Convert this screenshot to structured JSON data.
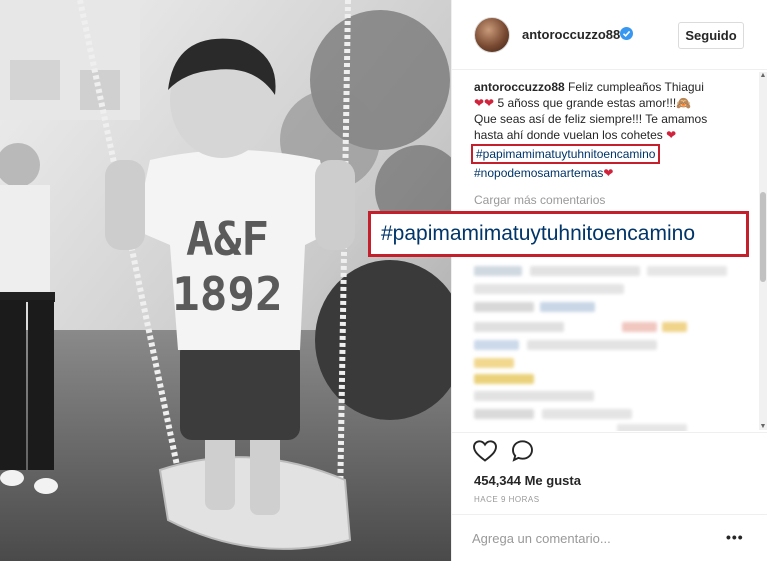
{
  "post": {
    "username": "antoroccuzzo88",
    "follow_label": "Seguido",
    "caption": {
      "username": "antoroccuzzo88",
      "line1_text": "Feliz cumpleaños Thiagui",
      "line2_hearts": "❤❤",
      "line2_text": " 5 añoss que grande estas amor!!!🙈",
      "line3_text": "Que seas así de feliz siempre!!! Te amamos",
      "line4_text": "hasta ahí donde vuelan los cohetes ",
      "line4_heart": "❤",
      "hashtag1": "#papimamimatuytuhnitoencamino",
      "hashtag2": "#nopodemosamartemas",
      "hashtag2_heart": "❤"
    },
    "load_more_label": "Cargar más comentarios",
    "likes_text": "454,344 Me gusta",
    "time_text": "HACE 9 HORAS",
    "comment_placeholder": "Agrega un comentario...",
    "more_label": "•••"
  },
  "overlay": {
    "hashtag": "#papimamimatuytuhnitoencamino"
  },
  "photo": {
    "shirt_line1": "A&F",
    "shirt_line2": "1892"
  },
  "colors": {
    "hashtag": "#003569",
    "highlight_border": "#c4202b",
    "heart": "#d0243c",
    "verified": "#3897f0"
  },
  "icons": [
    "verified-badge-icon",
    "heart-icon",
    "comment-bubble-icon",
    "more-options-icon"
  ]
}
